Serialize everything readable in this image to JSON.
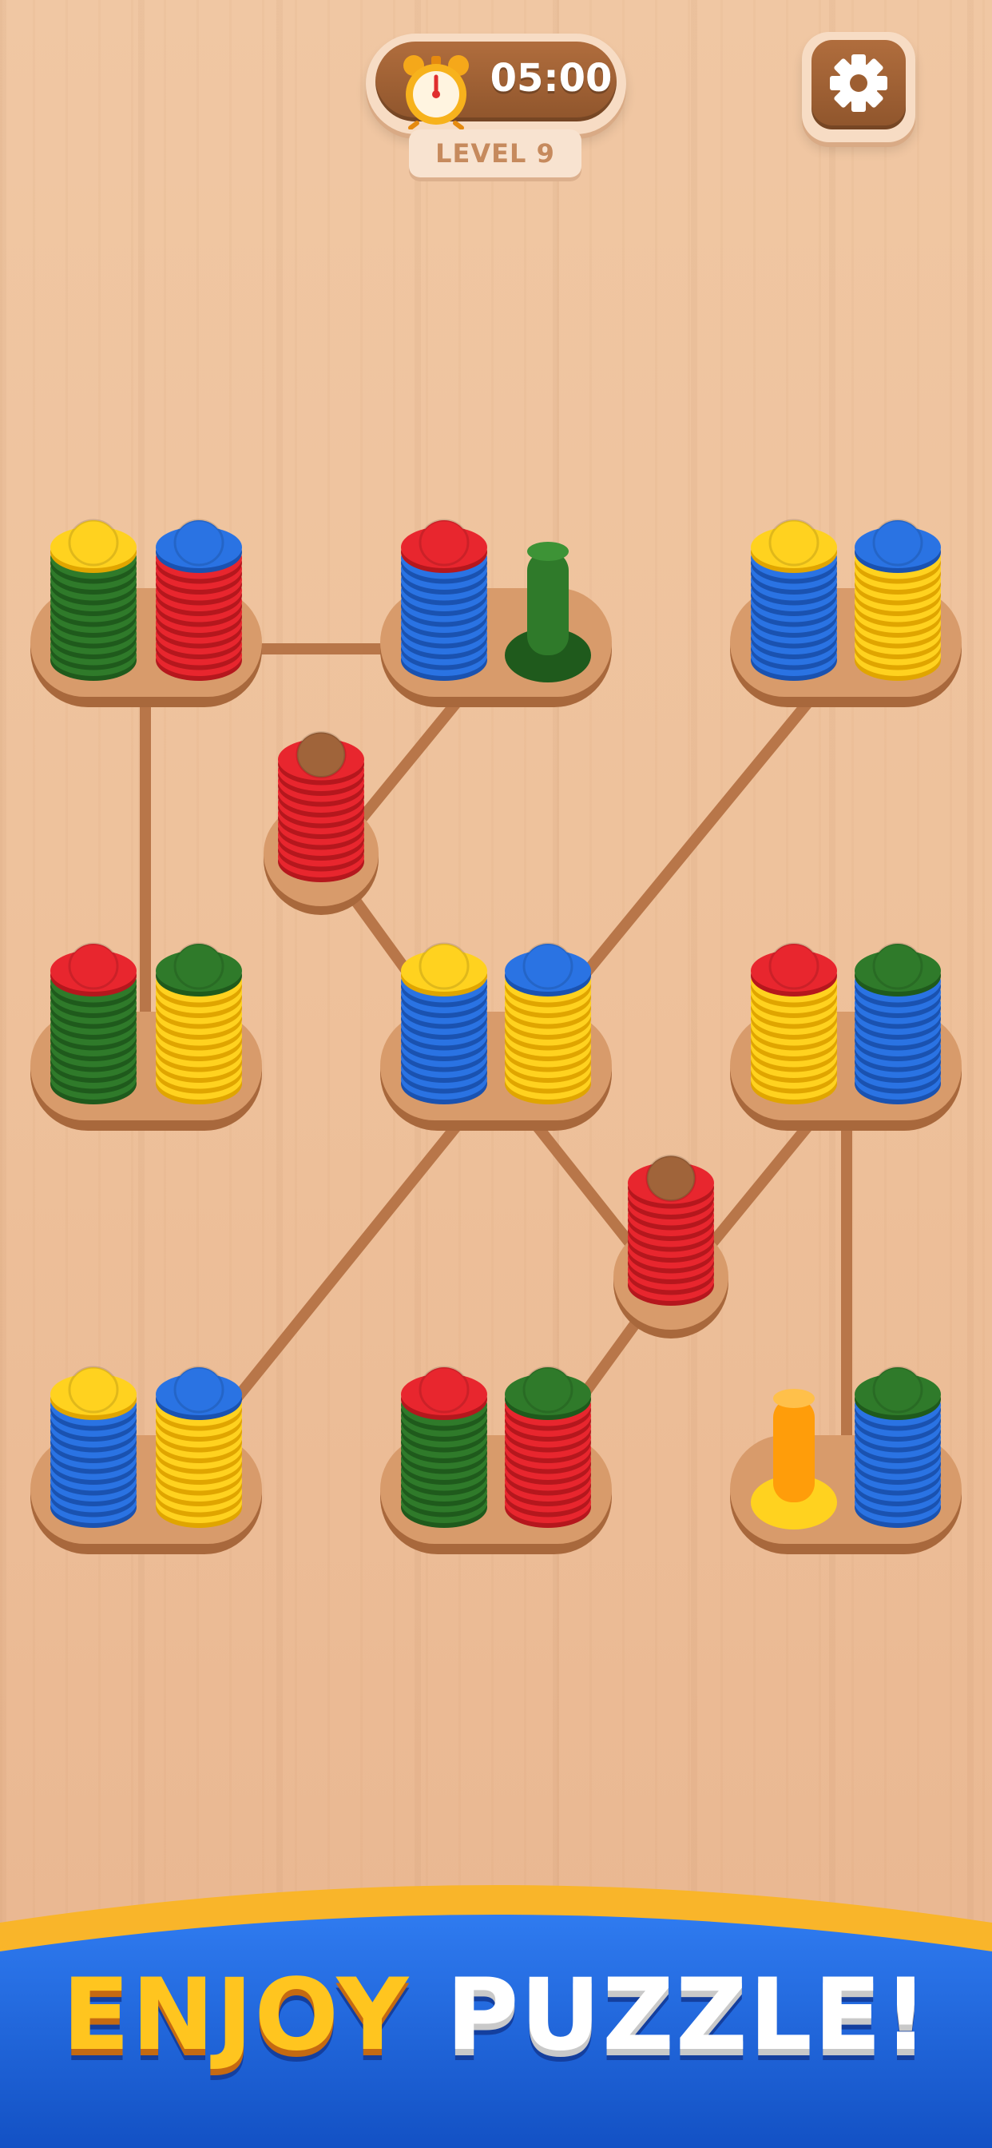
{
  "hud": {
    "timer": "05:00",
    "level": "LEVEL 9",
    "settings_icon": "gear-icon",
    "clock_icon": "alarm-clock-icon"
  },
  "banner": {
    "word1": "ENJOY",
    "word2": "PUZZLE!"
  },
  "colors": {
    "green": "#2f7a2a",
    "red": "#e8262e",
    "blue": "#2a73e3",
    "yellow": "#ffd21f",
    "brown": "#a0643a",
    "orange": "#ff9d0a",
    "wood": "#d79a6c",
    "banner_blue": "#1e63d8",
    "banner_rim": "#f6a91d"
  },
  "pegs": [
    {
      "id": "p1",
      "rings": [
        "green",
        "green",
        "green",
        "green",
        "green",
        "green",
        "green",
        "green",
        "green",
        "green",
        "yellow"
      ],
      "top": "yellow"
    },
    {
      "id": "p2",
      "rings": [
        "red",
        "red",
        "red",
        "red",
        "red",
        "red",
        "red",
        "red",
        "red",
        "red",
        "blue"
      ],
      "top": "blue"
    },
    {
      "id": "p3",
      "rings": [
        "blue",
        "blue",
        "blue",
        "blue",
        "blue",
        "blue",
        "blue",
        "blue",
        "blue",
        "blue",
        "red"
      ],
      "top": "red"
    },
    {
      "id": "p4",
      "rings": [],
      "top": "green",
      "empty_color": "green"
    },
    {
      "id": "p5",
      "rings": [
        "blue",
        "blue",
        "blue",
        "blue",
        "blue",
        "blue",
        "blue",
        "blue",
        "blue",
        "blue",
        "yellow"
      ],
      "top": "yellow"
    },
    {
      "id": "p6",
      "rings": [
        "yellow",
        "yellow",
        "yellow",
        "yellow",
        "yellow",
        "yellow",
        "yellow",
        "yellow",
        "yellow",
        "yellow",
        "blue"
      ],
      "top": "blue"
    },
    {
      "id": "p7",
      "rings": [
        "red",
        "red",
        "red",
        "red",
        "red",
        "red",
        "red",
        "red",
        "red",
        "red"
      ],
      "top": "brown"
    },
    {
      "id": "p8",
      "rings": [
        "green",
        "green",
        "green",
        "green",
        "green",
        "green",
        "green",
        "green",
        "green",
        "green",
        "red"
      ],
      "top": "red"
    },
    {
      "id": "p9",
      "rings": [
        "yellow",
        "yellow",
        "yellow",
        "yellow",
        "yellow",
        "yellow",
        "yellow",
        "yellow",
        "yellow",
        "yellow",
        "green"
      ],
      "top": "green"
    },
    {
      "id": "p10",
      "rings": [
        "blue",
        "blue",
        "blue",
        "blue",
        "blue",
        "blue",
        "blue",
        "blue",
        "blue",
        "blue",
        "yellow"
      ],
      "top": "yellow"
    },
    {
      "id": "p11",
      "rings": [
        "yellow",
        "yellow",
        "yellow",
        "yellow",
        "yellow",
        "yellow",
        "yellow",
        "yellow",
        "yellow",
        "yellow",
        "blue"
      ],
      "top": "blue"
    },
    {
      "id": "p12",
      "rings": [
        "yellow",
        "yellow",
        "yellow",
        "yellow",
        "yellow",
        "yellow",
        "yellow",
        "yellow",
        "yellow",
        "yellow",
        "red"
      ],
      "top": "red"
    },
    {
      "id": "p13",
      "rings": [
        "blue",
        "blue",
        "blue",
        "blue",
        "blue",
        "blue",
        "blue",
        "blue",
        "blue",
        "blue",
        "green"
      ],
      "top": "green"
    },
    {
      "id": "p14",
      "rings": [
        "red",
        "red",
        "red",
        "red",
        "red",
        "red",
        "red",
        "red",
        "red",
        "red"
      ],
      "top": "brown"
    },
    {
      "id": "p15",
      "rings": [
        "blue",
        "blue",
        "blue",
        "blue",
        "blue",
        "blue",
        "blue",
        "blue",
        "blue",
        "blue",
        "yellow"
      ],
      "top": "yellow"
    },
    {
      "id": "p16",
      "rings": [
        "yellow",
        "yellow",
        "yellow",
        "yellow",
        "yellow",
        "yellow",
        "yellow",
        "yellow",
        "yellow",
        "yellow",
        "blue"
      ],
      "top": "blue"
    },
    {
      "id": "p17",
      "rings": [
        "green",
        "green",
        "green",
        "green",
        "green",
        "green",
        "green",
        "green",
        "green",
        "green",
        "red"
      ],
      "top": "red"
    },
    {
      "id": "p18",
      "rings": [
        "red",
        "red",
        "red",
        "red",
        "red",
        "red",
        "red",
        "red",
        "red",
        "red",
        "green"
      ],
      "top": "green"
    },
    {
      "id": "p19",
      "rings": [],
      "top": "orange",
      "empty_color": "orange"
    },
    {
      "id": "p20",
      "rings": [
        "blue",
        "blue",
        "blue",
        "blue",
        "blue",
        "blue",
        "blue",
        "blue",
        "blue",
        "blue",
        "green"
      ],
      "top": "green"
    }
  ]
}
